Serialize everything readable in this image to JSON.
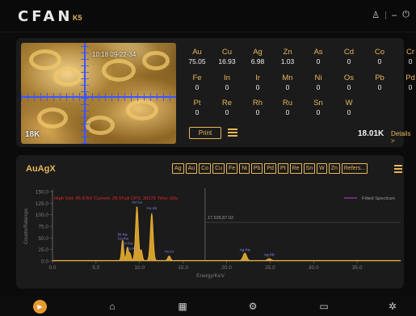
{
  "header": {
    "logo": "CFAN",
    "model": "K5",
    "user_icon": "user-icon",
    "minimize_icon": "minimize-icon",
    "power_icon": "power-icon"
  },
  "camera": {
    "stamp": "10:18 09-22-34",
    "karat": "18K"
  },
  "elements": [
    {
      "symbol": "Au",
      "value": "75.05"
    },
    {
      "symbol": "Cu",
      "value": "16.93"
    },
    {
      "symbol": "Ag",
      "value": "6.98"
    },
    {
      "symbol": "Zn",
      "value": "1.03"
    },
    {
      "symbol": "As",
      "value": "0"
    },
    {
      "symbol": "Cd",
      "value": "0"
    },
    {
      "symbol": "Co",
      "value": "0"
    },
    {
      "symbol": "Cr",
      "value": "0"
    },
    {
      "symbol": "Fe",
      "value": "0"
    },
    {
      "symbol": "In",
      "value": "0"
    },
    {
      "symbol": "Ir",
      "value": "0"
    },
    {
      "symbol": "Mn",
      "value": "0"
    },
    {
      "symbol": "Ni",
      "value": "0"
    },
    {
      "symbol": "Os",
      "value": "0"
    },
    {
      "symbol": "Pb",
      "value": "0"
    },
    {
      "symbol": "Pd",
      "value": "0"
    },
    {
      "symbol": "Pt",
      "value": "0"
    },
    {
      "symbol": "Re",
      "value": "0"
    },
    {
      "symbol": "Rh",
      "value": "0"
    },
    {
      "symbol": "Ru",
      "value": "0"
    },
    {
      "symbol": "Sn",
      "value": "0"
    },
    {
      "symbol": "W",
      "value": "0"
    }
  ],
  "result": {
    "print_label": "Print",
    "karat_total": "18.01K",
    "details_label": "Details >"
  },
  "spectrum": {
    "title": "AuAgX",
    "element_buttons": [
      "Ag",
      "Au",
      "Co",
      "Cu",
      "Fe",
      "Ni",
      "Pb",
      "Pd",
      "Pt",
      "Re",
      "Sn",
      "W",
      "Zn",
      "Refers..."
    ],
    "info_text": "High Volt: 45.87kV  Current: 29.97uA  CPS: 30175  Time: 60s",
    "legend_label": "Fitted Spectrum",
    "cursor_readout": "17.535,87.02",
    "xlabel": "Energy/KeV",
    "ylabel": "Counts/Rate/cps"
  },
  "chart_data": {
    "type": "line",
    "title": "",
    "xlabel": "Energy/KeV",
    "ylabel": "Counts/Rate/cps",
    "xlim": [
      0,
      40
    ],
    "ylim": [
      0,
      150
    ],
    "x_ticks": [
      "0.0",
      "5.0",
      "10.0",
      "15.0",
      "20.0",
      "25.0",
      "30.0",
      "35.0"
    ],
    "y_ticks": [
      "0.0",
      "25.0",
      "50.0",
      "75.0",
      "100.0",
      "125.0",
      "150.0"
    ],
    "series": [
      {
        "name": "Fitted Spectrum",
        "color": "#f2b530",
        "peaks": [
          {
            "x": 8.05,
            "y": 45,
            "w": 0.12
          },
          {
            "x": 8.6,
            "y": 28,
            "w": 0.12
          },
          {
            "x": 8.9,
            "y": 15,
            "w": 0.12
          },
          {
            "x": 9.7,
            "y": 118,
            "w": 0.16
          },
          {
            "x": 10.2,
            "y": 22,
            "w": 0.12
          },
          {
            "x": 11.4,
            "y": 102,
            "w": 0.16
          },
          {
            "x": 13.4,
            "y": 10,
            "w": 0.15
          },
          {
            "x": 22.1,
            "y": 16,
            "w": 0.2
          },
          {
            "x": 24.9,
            "y": 4,
            "w": 0.2
          }
        ]
      }
    ],
    "peak_labels": [
      {
        "text": "Au La",
        "x": 9.7,
        "y": 125
      },
      {
        "text": "Au Lb",
        "x": 11.4,
        "y": 112
      },
      {
        "text": "Ni Ka",
        "x": 8.05,
        "y": 55
      },
      {
        "text": "Cu Ka",
        "x": 8.1,
        "y": 46
      },
      {
        "text": "Zn Ka",
        "x": 8.6,
        "y": 36
      },
      {
        "text": "Cu Kb",
        "x": 9.1,
        "y": 24
      },
      {
        "text": "Au Lr",
        "x": 13.4,
        "y": 18
      },
      {
        "text": "Ag Ka",
        "x": 22.1,
        "y": 22
      },
      {
        "text": "Ag Kb",
        "x": 24.9,
        "y": 11
      }
    ],
    "cursor_x": 17.535,
    "grid": false,
    "legend_position": "top-right"
  },
  "nav": [
    {
      "icon": "start-icon",
      "glyph": "▶",
      "active": true
    },
    {
      "icon": "home-icon",
      "glyph": "⌂",
      "active": false
    },
    {
      "icon": "apps-icon",
      "glyph": "▦",
      "active": false
    },
    {
      "icon": "settings-icon",
      "glyph": "⚙",
      "active": false
    },
    {
      "icon": "folder-icon",
      "glyph": "▭",
      "active": false
    },
    {
      "icon": "tools-icon",
      "glyph": "✲",
      "active": false
    }
  ]
}
